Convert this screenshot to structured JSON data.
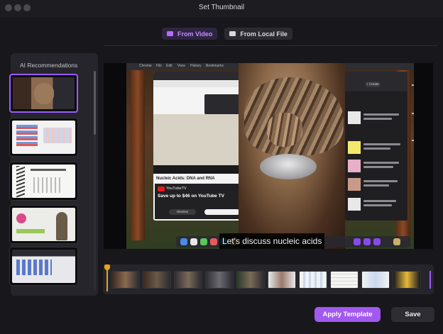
{
  "window": {
    "title": "Set Thumbnail"
  },
  "tabs": [
    {
      "label": "From Video",
      "icon": "video-icon",
      "active": true
    },
    {
      "label": "From Local File",
      "icon": "file-icon",
      "active": false
    }
  ],
  "sidebar": {
    "title": "AI Recommendations",
    "items": [
      {
        "label": "recommendation-1",
        "selected": true
      },
      {
        "label": "recommendation-2",
        "selected": false
      },
      {
        "label": "recommendation-3",
        "selected": false
      },
      {
        "label": "recommendation-4",
        "selected": false
      },
      {
        "label": "recommendation-5",
        "selected": false
      }
    ]
  },
  "preview": {
    "caption": "Let's discuss nucleic acids",
    "browser_video_title": "Nucleic Acids: DNA and RNA",
    "yt_brand": "YouTubeTV",
    "yt_promo": "Save up to $46 on YouTube TV",
    "yt_button_dismiss": "Dismiss",
    "b2_create": "+ Create"
  },
  "timeline": {
    "frame_count": 10
  },
  "actions": {
    "apply_label": "Apply Template",
    "save_label": "Save"
  },
  "colors": {
    "accent": "#a259f0",
    "accent_text": "#c58bff",
    "playhead": "#e8a318",
    "background": "#18181c",
    "panel": "#25252b"
  }
}
